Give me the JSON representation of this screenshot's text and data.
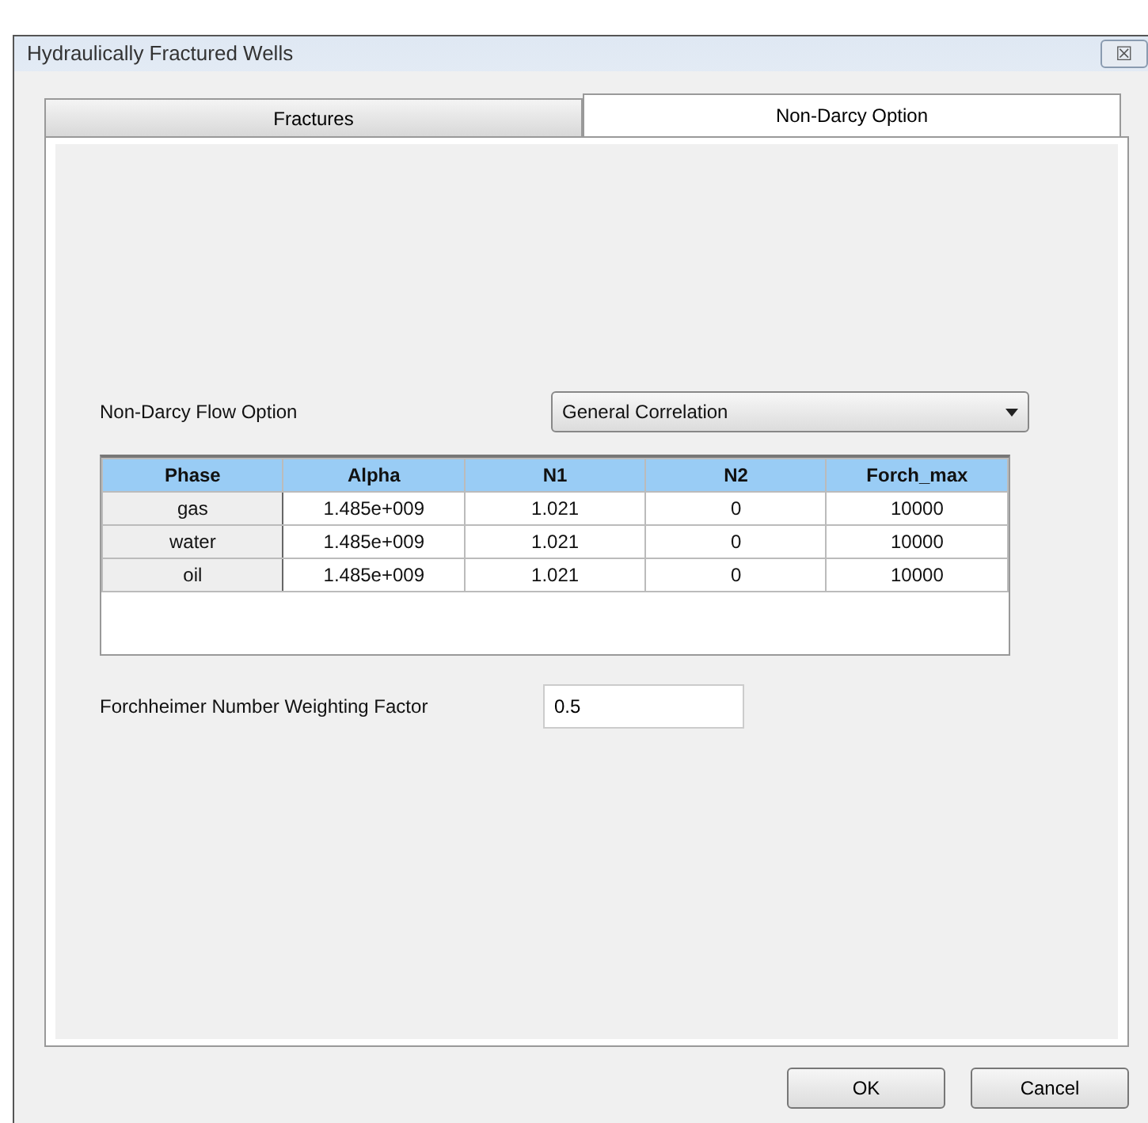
{
  "window": {
    "title": "Hydraulically Fractured Wells",
    "close": "☒"
  },
  "tabs": [
    {
      "label": "Fractures",
      "selected": false
    },
    {
      "label": "Non-Darcy Option",
      "selected": true
    }
  ],
  "flow_option": {
    "label": "Non-Darcy Flow Option",
    "value": "General Correlation"
  },
  "table": {
    "columns": [
      "Phase",
      "Alpha",
      "N1",
      "N2",
      "Forch_max"
    ],
    "rows": [
      [
        "gas",
        "1.485e+009",
        "1.021",
        "0",
        "10000"
      ],
      [
        "water",
        "1.485e+009",
        "1.021",
        "0",
        "10000"
      ],
      [
        "oil",
        "1.485e+009",
        "1.021",
        "0",
        "10000"
      ]
    ]
  },
  "weighting": {
    "label": "Forchheimer Number Weighting Factor",
    "value": "0.5"
  },
  "buttons": [
    "OK",
    "Cancel"
  ]
}
